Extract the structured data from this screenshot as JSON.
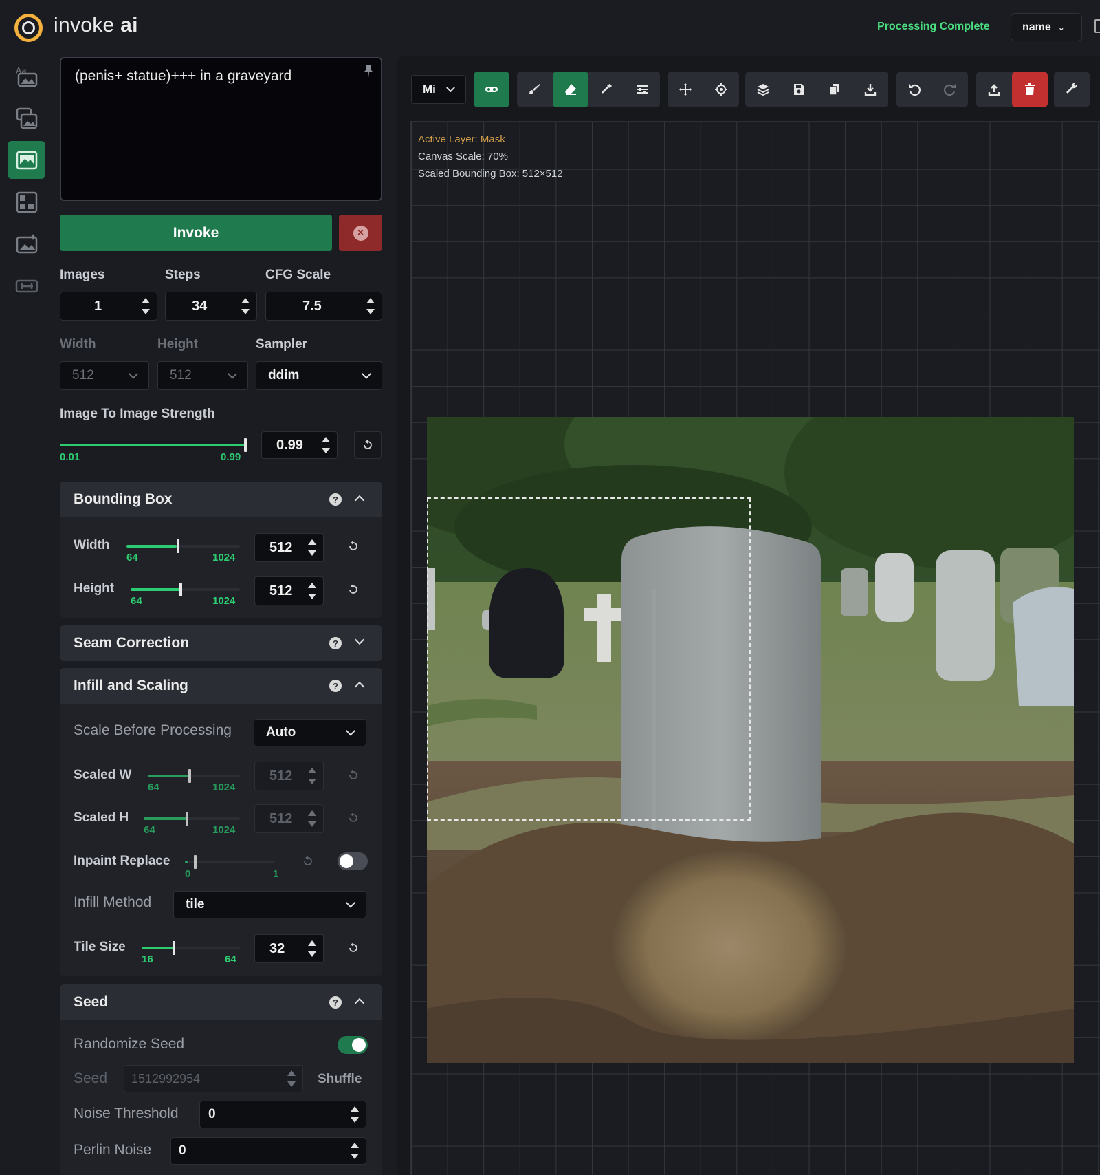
{
  "app": {
    "brand_light": "invoke ",
    "brand_bold": "ai",
    "status": "Processing Complete",
    "model": "name",
    "accent": "#1f7a4d",
    "status_color": "#4ade80"
  },
  "tabs": [
    {
      "name": "text-to-image-tab",
      "icon": "text-to-image-icon",
      "active": false
    },
    {
      "name": "image-to-image-tab",
      "icon": "image-to-image-icon",
      "active": false
    },
    {
      "name": "unified-canvas-tab",
      "icon": "canvas-icon",
      "active": true
    },
    {
      "name": "nodes-tab",
      "icon": "nodes-icon",
      "active": false
    },
    {
      "name": "postprocess-tab",
      "icon": "postprocess-icon",
      "active": false
    },
    {
      "name": "training-tab",
      "icon": "training-icon",
      "active": false
    }
  ],
  "prompt": {
    "text": "(penis+ statue)+++ in a graveyard"
  },
  "actions": {
    "invoke": "Invoke"
  },
  "params": {
    "images_label": "Images",
    "images": "1",
    "steps_label": "Steps",
    "steps": "34",
    "cfg_label": "CFG Scale",
    "cfg": "7.5",
    "width_label": "Width",
    "width": "512",
    "height_label": "Height",
    "height": "512",
    "sampler_label": "Sampler",
    "sampler": "ddim"
  },
  "img2img": {
    "label": "Image To Image Strength",
    "min": "0.01",
    "max": "0.99",
    "value": "0.99",
    "fraction": 1.0
  },
  "bounding_box": {
    "title": "Bounding Box",
    "width_label": "Width",
    "width": "512",
    "width_min": "64",
    "width_max": "1024",
    "height_label": "Height",
    "height": "512",
    "height_min": "64",
    "height_max": "1024"
  },
  "seam": {
    "title": "Seam Correction"
  },
  "infill": {
    "title": "Infill and Scaling",
    "scale_label": "Scale Before Processing",
    "scale_value": "Auto",
    "scaled_w_label": "Scaled W",
    "scaled_w": "512",
    "scaled_w_min": "64",
    "scaled_w_max": "1024",
    "scaled_h_label": "Scaled H",
    "scaled_h": "512",
    "scaled_h_min": "64",
    "scaled_h_max": "1024",
    "inpaint_label": "Inpaint Replace",
    "inpaint_min": "0",
    "inpaint_max": "1",
    "method_label": "Infill Method",
    "method": "tile",
    "tile_label": "Tile Size",
    "tile": "32",
    "tile_min": "16",
    "tile_max": "64"
  },
  "seed": {
    "title": "Seed",
    "randomize_label": "Randomize Seed",
    "randomize": true,
    "seed_label": "Seed",
    "seed_value": "1512992954",
    "shuffle": "Shuffle",
    "noise_label": "Noise Threshold",
    "noise": "0",
    "perlin_label": "Perlin Noise",
    "perlin": "0"
  },
  "toolbar": {
    "mode": "Mi"
  },
  "canvas": {
    "active_layer": "Active Layer: Mask",
    "scale": "Canvas Scale: 70%",
    "bbox": "Scaled Bounding Box: 512×512"
  }
}
